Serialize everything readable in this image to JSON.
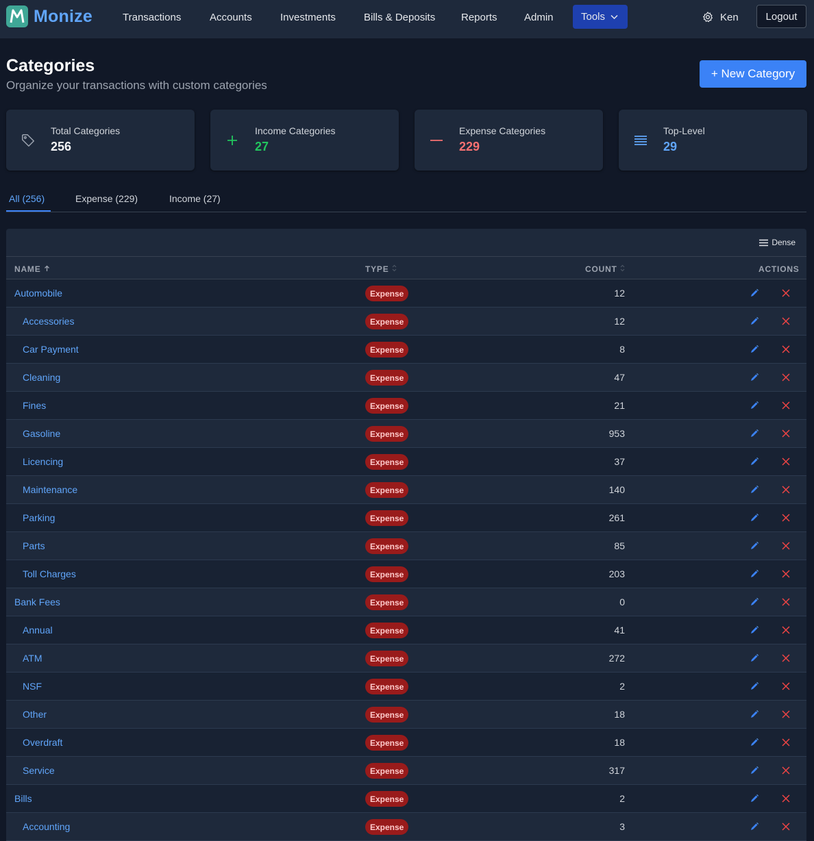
{
  "app": {
    "name": "Monize"
  },
  "nav": {
    "links": [
      "Transactions",
      "Accounts",
      "Investments",
      "Bills & Deposits",
      "Reports",
      "Admin"
    ],
    "tools_label": "Tools",
    "user_name": "Ken",
    "logout_label": "Logout"
  },
  "header": {
    "title": "Categories",
    "subtitle": "Organize your transactions with custom categories",
    "new_button": "+ New Category"
  },
  "stats": [
    {
      "label": "Total Categories",
      "value": "256",
      "color": "#f3f4f6",
      "icon": "tag-icon"
    },
    {
      "label": "Income Categories",
      "value": "27",
      "color": "#22c55e",
      "icon": "plus-icon"
    },
    {
      "label": "Expense Categories",
      "value": "229",
      "color": "#f87171",
      "icon": "minus-icon"
    },
    {
      "label": "Top-Level",
      "value": "29",
      "color": "#60a5fa",
      "icon": "list-icon"
    }
  ],
  "tabs": [
    {
      "label": "All (256)",
      "active": true
    },
    {
      "label": "Expense (229)",
      "active": false
    },
    {
      "label": "Income (27)",
      "active": false
    }
  ],
  "table": {
    "dense_label": "Dense",
    "columns": {
      "name": "NAME",
      "type": "TYPE",
      "count": "COUNT",
      "actions": "ACTIONS"
    },
    "rows": [
      {
        "name": "Automobile",
        "type": "Expense",
        "count": "12",
        "child": false
      },
      {
        "name": "Accessories",
        "type": "Expense",
        "count": "12",
        "child": true
      },
      {
        "name": "Car Payment",
        "type": "Expense",
        "count": "8",
        "child": true
      },
      {
        "name": "Cleaning",
        "type": "Expense",
        "count": "47",
        "child": true
      },
      {
        "name": "Fines",
        "type": "Expense",
        "count": "21",
        "child": true
      },
      {
        "name": "Gasoline",
        "type": "Expense",
        "count": "953",
        "child": true
      },
      {
        "name": "Licencing",
        "type": "Expense",
        "count": "37",
        "child": true
      },
      {
        "name": "Maintenance",
        "type": "Expense",
        "count": "140",
        "child": true
      },
      {
        "name": "Parking",
        "type": "Expense",
        "count": "261",
        "child": true
      },
      {
        "name": "Parts",
        "type": "Expense",
        "count": "85",
        "child": true
      },
      {
        "name": "Toll Charges",
        "type": "Expense",
        "count": "203",
        "child": true
      },
      {
        "name": "Bank Fees",
        "type": "Expense",
        "count": "0",
        "child": false
      },
      {
        "name": "Annual",
        "type": "Expense",
        "count": "41",
        "child": true
      },
      {
        "name": "ATM",
        "type": "Expense",
        "count": "272",
        "child": true
      },
      {
        "name": "NSF",
        "type": "Expense",
        "count": "2",
        "child": true
      },
      {
        "name": "Other",
        "type": "Expense",
        "count": "18",
        "child": true
      },
      {
        "name": "Overdraft",
        "type": "Expense",
        "count": "18",
        "child": true
      },
      {
        "name": "Service",
        "type": "Expense",
        "count": "317",
        "child": true
      },
      {
        "name": "Bills",
        "type": "Expense",
        "count": "2",
        "child": false
      },
      {
        "name": "Accounting",
        "type": "Expense",
        "count": "3",
        "child": true
      }
    ]
  },
  "colors": {
    "accent": "#3b82f6",
    "link": "#60a5fa",
    "expense_badge": "#991b1b",
    "delete": "#ef4444"
  }
}
